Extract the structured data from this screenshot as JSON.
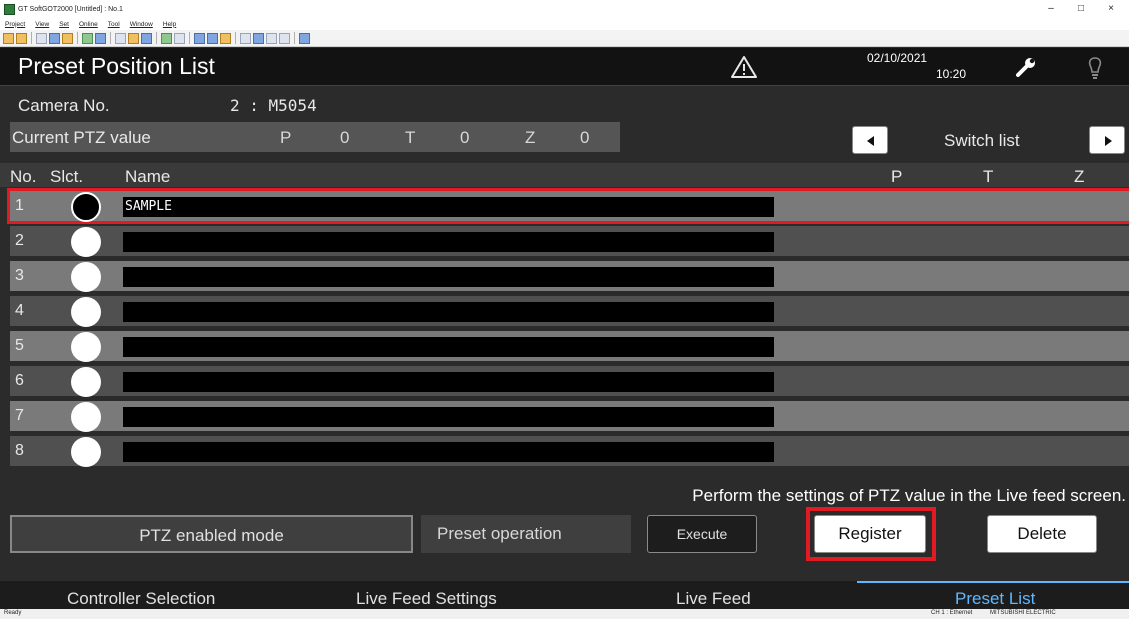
{
  "window": {
    "title": "GT SoftGOT2000 [Untitled] : No.1",
    "controls": {
      "minimize": "–",
      "maximize": "□",
      "close": "×"
    }
  },
  "menu": [
    "Project",
    "View",
    "Set",
    "Online",
    "Tool",
    "Window",
    "Help"
  ],
  "header": {
    "title": "Preset Position List",
    "date": "02/10/2021",
    "time": "10:20",
    "icons": [
      "warning-icon",
      "wrench-icon",
      "lightbulb-icon"
    ]
  },
  "camera": {
    "label": "Camera No.",
    "value": "2 : M5054"
  },
  "ptz": {
    "label": "Current PTZ value",
    "p_label": "P",
    "p_value": "0",
    "t_label": "T",
    "t_value": "0",
    "z_label": "Z",
    "z_value": "0"
  },
  "switch_list": {
    "label": "Switch list"
  },
  "table": {
    "headers": {
      "no": "No.",
      "slct": "Slct.",
      "name": "Name",
      "p": "P",
      "t": "T",
      "z": "Z"
    },
    "rows": [
      {
        "no": "1",
        "name": "SAMPLE",
        "selected": true
      },
      {
        "no": "2",
        "name": "",
        "selected": false
      },
      {
        "no": "3",
        "name": "",
        "selected": false
      },
      {
        "no": "4",
        "name": "",
        "selected": false
      },
      {
        "no": "5",
        "name": "",
        "selected": false
      },
      {
        "no": "6",
        "name": "",
        "selected": false
      },
      {
        "no": "7",
        "name": "",
        "selected": false
      },
      {
        "no": "8",
        "name": "",
        "selected": false
      }
    ]
  },
  "hint": "Perform the settings of PTZ value in the Live feed screen.",
  "controls": {
    "mode": "PTZ enabled mode",
    "preset_operation": "Preset operation",
    "execute": "Execute",
    "register": "Register",
    "delete": "Delete"
  },
  "nav": [
    {
      "label": "Controller Selection",
      "active": false
    },
    {
      "label": "Live Feed Settings",
      "active": false
    },
    {
      "label": "Live Feed",
      "active": false
    },
    {
      "label": "Preset List",
      "active": true
    }
  ],
  "status": {
    "left": "Ready",
    "channel": "CH 1 : Ethernet",
    "brand": "MITSUBISHI ELECTRIC"
  },
  "colors": {
    "highlight": "#e01b24",
    "active_tab": "#5fb8ff"
  }
}
